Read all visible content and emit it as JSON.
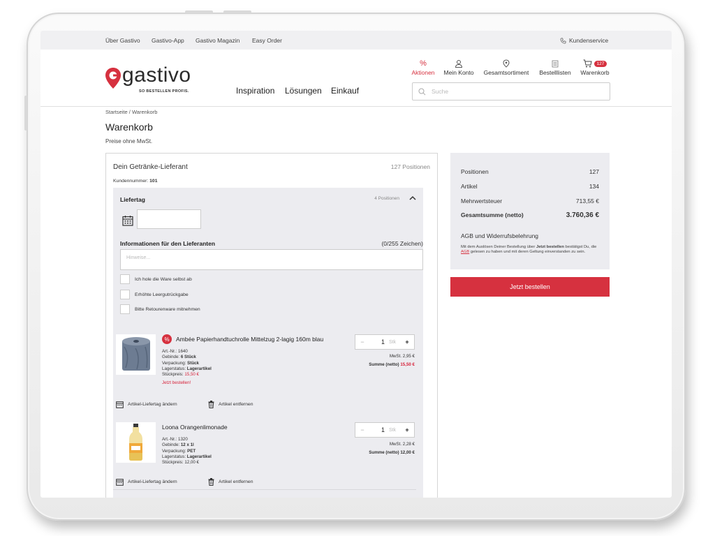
{
  "topbar": {
    "links": [
      "Über Gastivo",
      "Gastivo-App",
      "Gastivo Magazin",
      "Easy Order"
    ],
    "kundenservice": "Kundenservice"
  },
  "logo": {
    "name": "gastivo",
    "tagline": "SO BESTELLEN PROFIS."
  },
  "nav": [
    "Inspiration",
    "Lösungen",
    "Einkauf"
  ],
  "header_icons": {
    "aktionen": "Aktionen",
    "konto": "Mein Konto",
    "sortiment": "Gesamtsortiment",
    "listen": "Bestelllisten",
    "warenkorb": "Warenkorb",
    "cart_count": "127"
  },
  "search": {
    "placeholder": "Suche"
  },
  "breadcrumb": {
    "home": "Startseite",
    "sep": "/",
    "current": "Warenkorb"
  },
  "page": {
    "title": "Warenkorb",
    "subtitle": "Preise ohne MwSt."
  },
  "supplier": {
    "name": "Dein Getränke-Lieferant",
    "positions": "127 Positionen",
    "kundennummer_label": "Kundennummer:",
    "kundennummer": "101",
    "liefertag_label": "Liefertag",
    "liefertag_positions": "4 Positionen",
    "info_label": "Informationen für den Lieferanten",
    "info_count": "(0/255 Zeichen)",
    "info_placeholder": "Hinweise...",
    "options": [
      "Ich hole die Ware selbst ab",
      "Erhöhte Leergutrückgabe",
      "Bitte Retourenware mitnehmen"
    ]
  },
  "items": [
    {
      "name": "Ambée Papierhandtuchrolle Mittelzug 2-lagig 160m blau",
      "artnr_label": "Art.-Nr.:",
      "artnr": "1640",
      "gebinde_label": "Gebinde:",
      "gebinde": "6 Stück",
      "verpackung_label": "Verpackung:",
      "verpackung": "Stück",
      "lager_label": "Lagerstatus:",
      "lager": "Lagerartikel",
      "preis_label": "Stückpreis:",
      "preis": "15,50 €",
      "promo": "Jetzt bestellen!",
      "qty": "1",
      "unit": "Stk",
      "mwst": "MwSt. 2,95 €",
      "summe_label": "Summe (netto)",
      "summe": "15,50 €",
      "change": "Artikel-Liefertag ändern",
      "remove": "Artikel entfernen"
    },
    {
      "name": "Loona Orangenlimonade",
      "artnr_label": "Art.-Nr.:",
      "artnr": "1320",
      "gebinde_label": "Gebinde:",
      "gebinde": "12 x 1l",
      "verpackung_label": "Verpackung:",
      "verpackung": "PET",
      "lager_label": "Lagerstatus:",
      "lager": "Lagerartikel",
      "preis_label": "Stückpreis:",
      "preis": "12,00 €",
      "qty": "1",
      "unit": "Stk",
      "mwst": "MwSt. 2,28 €",
      "summe_label": "Summe (netto)",
      "summe": "12,00 €",
      "change": "Artikel-Liefertag ändern",
      "remove": "Artikel entfernen"
    }
  ],
  "summary": {
    "positionen_label": "Positionen",
    "positionen": "127",
    "artikel_label": "Artikel",
    "artikel": "134",
    "mwst_label": "Mehrwertsteuer",
    "mwst": "713,55 €",
    "gesamt_label": "Gesamtsumme (netto)",
    "gesamt": "3.760,36 €",
    "agb_title": "AGB und Widerrufsbelehrung",
    "agb_text_1": "Mit dem Auslösen Deiner Bestellung über",
    "agb_text_bold": "Jetzt bestellen",
    "agb_text_2": "bestätigst Du, die",
    "agb_link": "AGB",
    "agb_text_3": "gelesen zu haben und mit deren Geltung einverstanden zu sein."
  },
  "cta": "Jetzt bestellen",
  "colors": {
    "brand_red": "#d6313f",
    "panel_gray": "#ececf0"
  }
}
